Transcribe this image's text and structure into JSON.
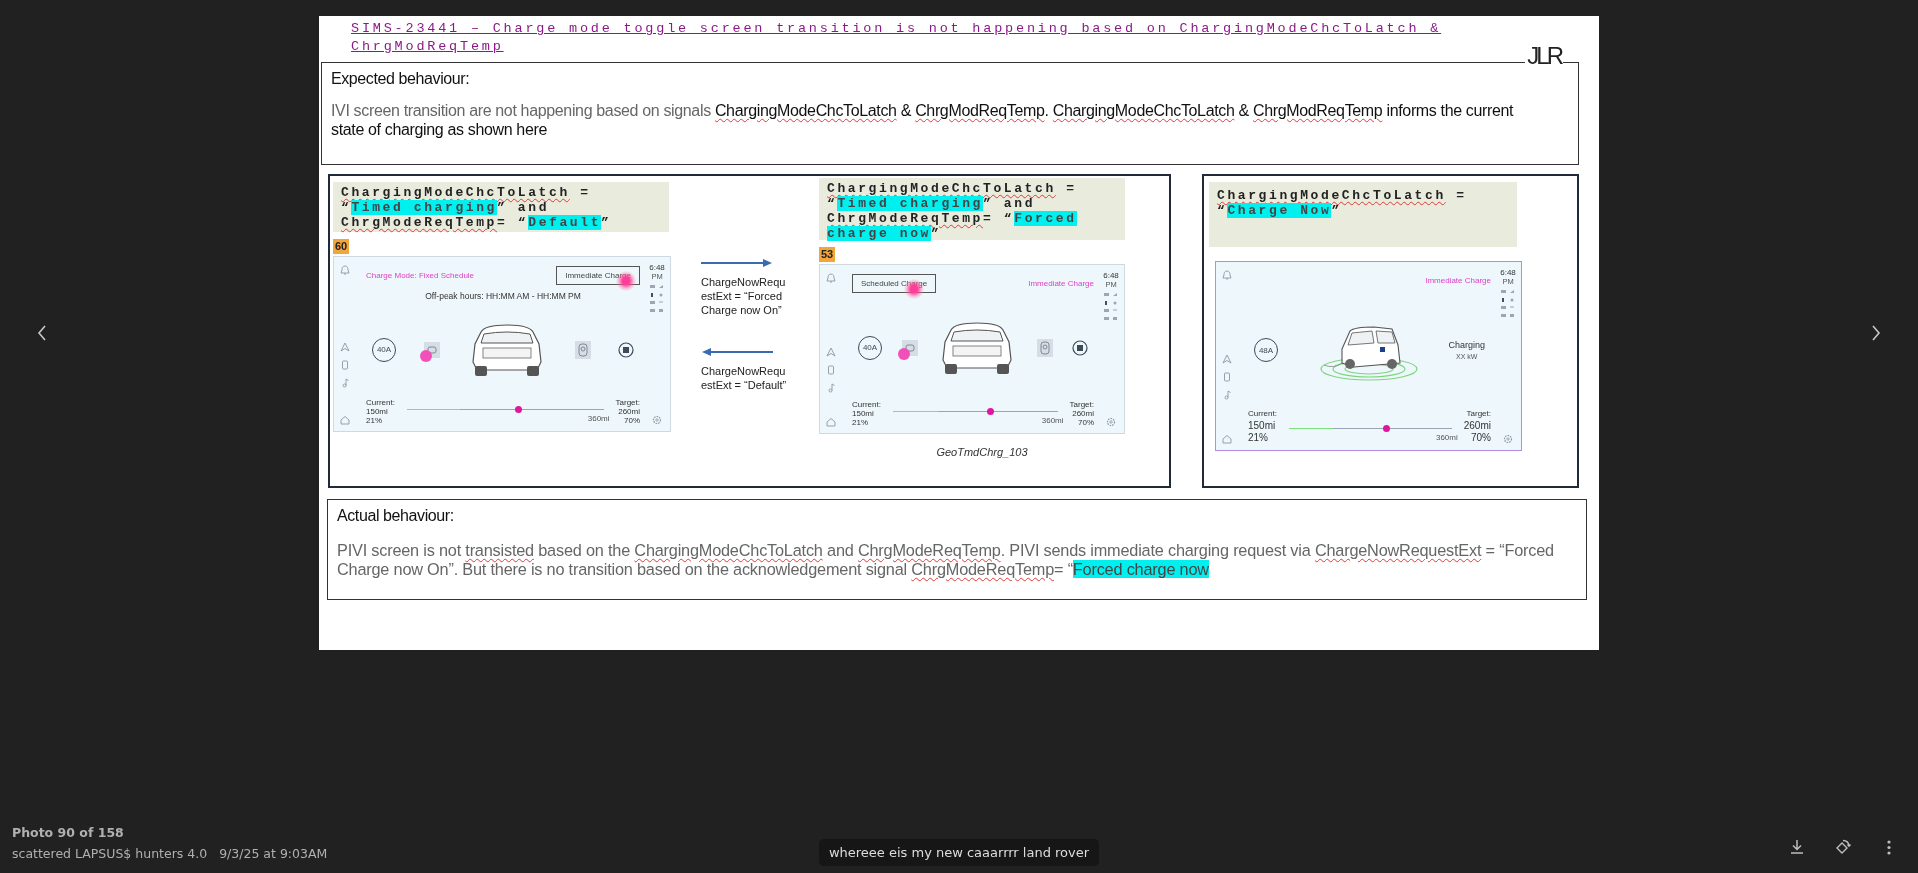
{
  "viewer": {
    "counter": "Photo 90 of 158",
    "album": "scattered LAPSUS$ hunters 4.0",
    "date": "9/3/25 at 9:03AM",
    "caption": "whereee eis my new caaarrrr land rover"
  },
  "slide": {
    "title": "SIMS-23441 – Charge mode toggle screen transition is not happening based on ChargingModeChcToLatch & ChrgModReqTemp",
    "logo": "JLR",
    "expected": {
      "heading": "Expected behaviour:",
      "body": [
        {
          "kind": "plain",
          "text": "IVI screen transition are not happening based on signals "
        },
        {
          "kind": "strong-flagged",
          "text": "ChargingModeChcToLatch"
        },
        {
          "kind": "strong",
          "text": " & "
        },
        {
          "kind": "strong-flagged",
          "text": "ChrgModReqTemp"
        },
        {
          "kind": "strong",
          "text": ". "
        },
        {
          "kind": "strong-flagged",
          "text": "ChargingModeChcToLatch"
        },
        {
          "kind": "strong",
          "text": " & "
        },
        {
          "kind": "strong-flagged",
          "text": "ChrgModReqTemp"
        },
        {
          "kind": "strong",
          "text": " informs the current state of charging as shown here"
        }
      ]
    },
    "comparison": {
      "states": [
        {
          "label": [
            {
              "kind": "flagged",
              "text": "ChargingModeChcToLatch"
            },
            {
              "kind": "plain",
              "text": " = “"
            },
            {
              "kind": "highlight",
              "text": "Timed charging"
            },
            {
              "kind": "plain",
              "text": "” and "
            },
            {
              "kind": "flagged",
              "text": "ChrgModeReqTemp"
            },
            {
              "kind": "plain",
              "text": "= “"
            },
            {
              "kind": "highlight",
              "text": "Default"
            },
            {
              "kind": "plain",
              "text": "”"
            }
          ],
          "badge": "60",
          "device": {
            "kind": "schedule",
            "top": [
              {
                "kind": "mode",
                "text": "Charge Mode: Fixed Schedule"
              },
              {
                "kind": "button",
                "text": "Immediate Charge"
              }
            ],
            "tap_marks": true,
            "hours": "Off-peak hours: HH:MM AM - HH:MM PM",
            "amp": "40A",
            "time": "6:48",
            "meridiem": "PM",
            "current": {
              "label": "Current:",
              "range": "150mi",
              "percent": "21%"
            },
            "max": "360mi",
            "target": {
              "label": "Target:",
              "range": "260mi",
              "percent": "70%"
            },
            "level": 0.57
          }
        },
        {
          "label": [
            {
              "kind": "flagged",
              "text": "ChargingModeChcToLatch"
            },
            {
              "kind": "plain",
              "text": " = “"
            },
            {
              "kind": "highlight",
              "text": "Timed charging"
            },
            {
              "kind": "plain",
              "text": "” and "
            },
            {
              "kind": "flagged",
              "text": "ChrgModeReqTemp"
            },
            {
              "kind": "plain",
              "text": "= “"
            },
            {
              "kind": "highlight",
              "text": "Forced charge now"
            },
            {
              "kind": "plain",
              "text": "”"
            }
          ],
          "badge": "53",
          "device": {
            "kind": "scheduled",
            "top": [
              {
                "kind": "button",
                "text": "Scheduled Charge"
              },
              {
                "kind": "mode",
                "text": "Immediate Charge"
              }
            ],
            "tap_marks": true,
            "amp": "40A",
            "time": "6:48",
            "meridiem": "PM",
            "current": {
              "label": "Current:",
              "range": "150mi",
              "percent": "21%"
            },
            "max": "360mi",
            "target": {
              "label": "Target:",
              "range": "260mi",
              "percent": "70%"
            },
            "level": 0.59
          }
        }
      ],
      "transitions": [
        {
          "kind": "forward",
          "lines": [
            "ChargeNowRequ",
            "estExt = “Forced",
            "Charge now On”"
          ]
        },
        {
          "kind": "backward",
          "lines": [
            "ChargeNowRequ",
            "estExt = “Default”"
          ]
        }
      ],
      "caption": "GeoTmdChrg_103"
    },
    "result": {
      "label": [
        {
          "kind": "flagged",
          "text": "ChargingModeChcToLatch"
        },
        {
          "kind": "plain",
          "text": " = “"
        },
        {
          "kind": "highlight",
          "text": "Charge Now"
        },
        {
          "kind": "plain",
          "text": "”"
        }
      ],
      "device": {
        "kind": "charging",
        "top": [
          {
            "kind": "mode",
            "text": "Immediate Charge"
          }
        ],
        "tap_marks": false,
        "amp": "48A",
        "status": {
          "title": "Charging",
          "value": "XX kW"
        },
        "time": "6:48",
        "meridiem": "PM",
        "current": {
          "label": "Current:",
          "range": "150mi",
          "percent": "21%"
        },
        "max": "360mi",
        "target": {
          "label": "Target:",
          "range": "260mi",
          "percent": "70%"
        },
        "level": 0.6
      }
    },
    "actual": {
      "heading": "Actual behaviour:",
      "body": [
        {
          "kind": "plain",
          "text": "PIVI screen is not "
        },
        {
          "kind": "flagged",
          "text": "transisted"
        },
        {
          "kind": "plain",
          "text": " based on the "
        },
        {
          "kind": "flagged",
          "text": "ChargingModeChcToLatch"
        },
        {
          "kind": "plain",
          "text": " and "
        },
        {
          "kind": "flagged",
          "text": "ChrgModeReqTemp"
        },
        {
          "kind": "plain",
          "text": ". PIVI sends immediate charging request via "
        },
        {
          "kind": "flagged",
          "text": "ChargeNowRequestExt"
        },
        {
          "kind": "plain",
          "text": " = “Forced Charge now On”. But there is no transition based on the acknowledgement signal "
        },
        {
          "kind": "flagged",
          "text": "ChrgModeReqTemp"
        },
        {
          "kind": "plain",
          "text": "= “"
        },
        {
          "kind": "highlight",
          "text": "Forced charge now"
        }
      ]
    }
  }
}
